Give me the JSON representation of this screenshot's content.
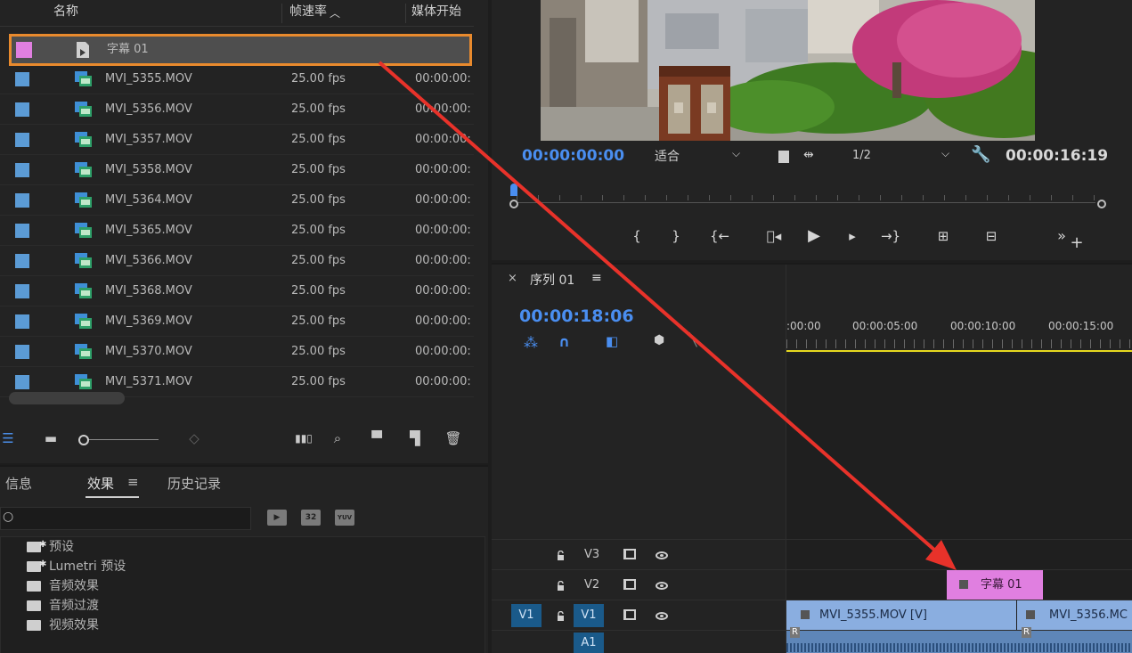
{
  "project": {
    "columns": {
      "name": "名称",
      "frame_rate": "帧速率",
      "media_start": "媒体开始"
    },
    "selected_item": {
      "name": "字幕 01",
      "color": "#e07fe0"
    },
    "items": [
      {
        "name": "MVI_5355.MOV",
        "fps": "25.00 fps",
        "start": "00:00:00:"
      },
      {
        "name": "MVI_5356.MOV",
        "fps": "25.00 fps",
        "start": "00:00:00:"
      },
      {
        "name": "MVI_5357.MOV",
        "fps": "25.00 fps",
        "start": "00:00:00:"
      },
      {
        "name": "MVI_5358.MOV",
        "fps": "25.00 fps",
        "start": "00:00:00:"
      },
      {
        "name": "MVI_5364.MOV",
        "fps": "25.00 fps",
        "start": "00:00:00:"
      },
      {
        "name": "MVI_5365.MOV",
        "fps": "25.00 fps",
        "start": "00:00:00:"
      },
      {
        "name": "MVI_5366.MOV",
        "fps": "25.00 fps",
        "start": "00:00:00:"
      },
      {
        "name": "MVI_5368.MOV",
        "fps": "25.00 fps",
        "start": "00:00:00:"
      },
      {
        "name": "MVI_5369.MOV",
        "fps": "25.00 fps",
        "start": "00:00:00:"
      },
      {
        "name": "MVI_5370.MOV",
        "fps": "25.00 fps",
        "start": "00:00:00:"
      },
      {
        "name": "MVI_5371.MOV",
        "fps": "25.00 fps",
        "start": "00:00:00:"
      }
    ],
    "item_color": "#5b9bd5",
    "selection_outline_color": "#e98a2d"
  },
  "effects_panel": {
    "tabs": [
      "信息",
      "效果",
      "历史记录"
    ],
    "tab_menu_icon": "≡",
    "search_value": "",
    "badges": [
      "32",
      "YUV"
    ],
    "folders": [
      "预设",
      "Lumetri 预设",
      "音频效果",
      "音频过渡",
      "视频效果"
    ]
  },
  "monitor": {
    "current_time": "00:00:00:00",
    "fit": "适合",
    "resolution": "1/2",
    "duration": "00:00:16:19"
  },
  "timeline": {
    "sequence_name": "序列 01",
    "current_time": "00:00:18:06",
    "ruler_labels": [
      ":00:00",
      "00:00:05:00",
      "00:00:10:00",
      "00:00:15:00"
    ],
    "tracks": [
      {
        "name": "V3"
      },
      {
        "name": "V2"
      },
      {
        "name": "V1",
        "source": "V1"
      },
      {
        "name": "A1"
      }
    ],
    "title_clip": "字幕 01",
    "clips_v1": [
      "MVI_5355.MOV [V]",
      "MVI_5356.MC"
    ],
    "audio_clip_label": "R",
    "title_clip_color": "#e07fe0",
    "video_clip_color": "#8aaee0"
  },
  "annotation": {
    "arrow_color": "#e8322a"
  }
}
